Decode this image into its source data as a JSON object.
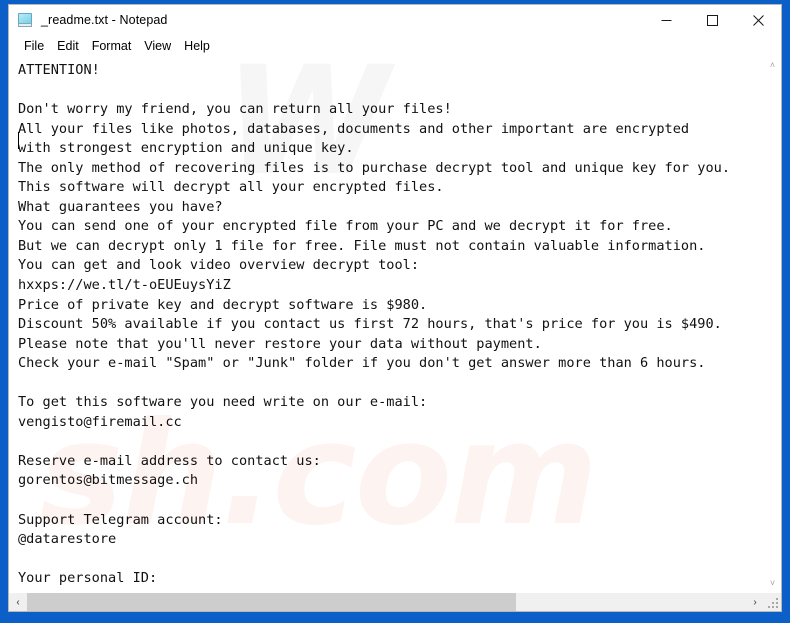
{
  "window": {
    "title": "_readme.txt - Notepad",
    "icon": "notepad-icon",
    "controls": {
      "minimize_label": "─",
      "maximize_label": "□",
      "close_label": "✕"
    }
  },
  "menu": {
    "items": [
      {
        "label": "File"
      },
      {
        "label": "Edit"
      },
      {
        "label": "Format"
      },
      {
        "label": "View"
      },
      {
        "label": "Help"
      }
    ]
  },
  "editor": {
    "content": "ATTENTION!\n\nDon't worry my friend, you can return all your files!\nAll your files like photos, databases, documents and other important are encrypted\nwith strongest encryption and unique key.\nThe only method of recovering files is to purchase decrypt tool and unique key for you.\nThis software will decrypt all your encrypted files.\nWhat guarantees you have?\nYou can send one of your encrypted file from your PC and we decrypt it for free.\nBut we can decrypt only 1 file for free. File must not contain valuable information.\nYou can get and look video overview decrypt tool:\nhxxps://we.tl/t-oEUEuysYiZ\nPrice of private key and decrypt software is $980.\nDiscount 50% available if you contact us first 72 hours, that's price for you is $490.\nPlease note that you'll never restore your data without payment.\nCheck your e-mail \"Spam\" or \"Junk\" folder if you don't get answer more than 6 hours.\n\nTo get this software you need write on our e-mail:\nvengisto@firemail.cc\n\nReserve e-mail address to contact us:\ngorentos@bitmessage.ch\n\nSupport Telegram account:\n@datarestore\n\nYour personal ID:\n-",
    "lines": [
      "ATTENTION!",
      "",
      "Don't worry my friend, you can return all your files!",
      "All your files like photos, databases, documents and other important are encrypted",
      "with strongest encryption and unique key.",
      "The only method of recovering files is to purchase decrypt tool and unique key for you.",
      "This software will decrypt all your encrypted files.",
      "What guarantees you have?",
      "You can send one of your encrypted file from your PC and we decrypt it for free.",
      "But we can decrypt only 1 file for free. File must not contain valuable information.",
      "You can get and look video overview decrypt tool:",
      "hxxps://we.tl/t-oEUEuysYiZ",
      "Price of private key and decrypt software is $980.",
      "Discount 50% available if you contact us first 72 hours, that's price for you is $490.",
      "Please note that you'll never restore your data without payment.",
      "Check your e-mail \"Spam\" or \"Junk\" folder if you don't get answer more than 6 hours.",
      "",
      "To get this software you need write on our e-mail:",
      "vengisto@firemail.cc",
      "",
      "Reserve e-mail address to contact us:",
      "gorentos@bitmessage.ch",
      "",
      "Support Telegram account:",
      "@datarestore",
      "",
      "Your personal ID:",
      "-"
    ],
    "details": {
      "price_full": "$980",
      "price_discount": "$490",
      "discount_percent": "50%",
      "discount_window_hours": "72 hours",
      "response_time": "6 hours",
      "free_decrypt_files": "1",
      "video_url": "hxxps://we.tl/t-oEUEuysYiZ",
      "primary_email": "vengisto@firemail.cc",
      "reserve_email": "gorentos@bitmessage.ch",
      "telegram": "@datarestore",
      "personal_id": "-"
    }
  },
  "watermark": {
    "top_text": "W",
    "bottom_text": "sh.com"
  },
  "scrollbars": {
    "vertical": {
      "up_arrow": "˄",
      "down_arrow": "˅"
    },
    "horizontal": {
      "left_arrow": "‹",
      "right_arrow": "›",
      "thumb_fraction": "68%"
    }
  },
  "colors": {
    "desktop_blue": "#0b5fc6",
    "window_bg": "#ffffff",
    "text": "#111111",
    "scroll_thumb": "#cdcdcd",
    "scroll_track": "#f0f0f0"
  }
}
